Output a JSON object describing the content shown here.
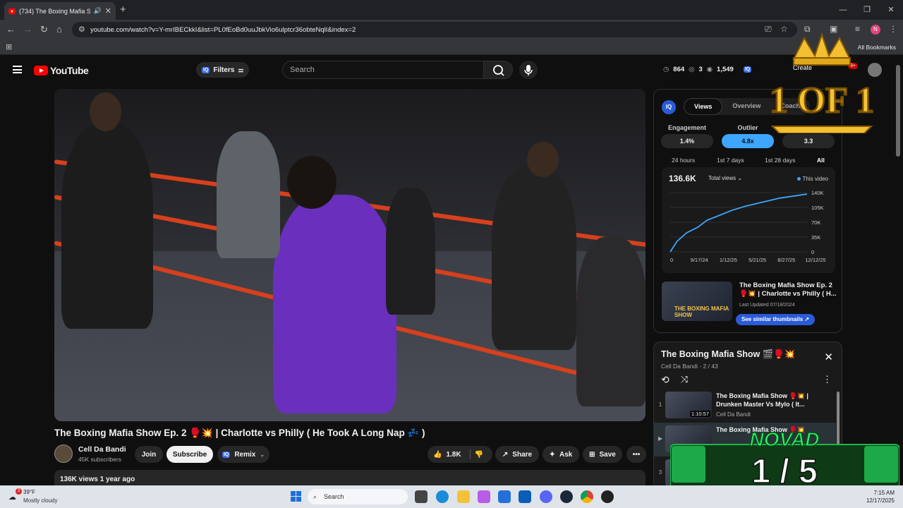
{
  "browser": {
    "tab_title": "(734) The Boxing Mafia Show",
    "url": "youtube.com/watch?v=Y-mrIBECkkI&list=PL0fEoBd0uuJbkVio6ulptcr36obteNqlI&index=2",
    "profile_initial": "N",
    "all_bookmarks": "All Bookmarks"
  },
  "youtube": {
    "logo_text": "YouTube",
    "filters_label": "Filters",
    "search_placeholder": "Search",
    "header_stats": [
      "864",
      "3",
      "1,549"
    ],
    "create_label": "Create",
    "notif_count": "9+"
  },
  "video": {
    "title": "The Boxing Mafia Show Ep. 2 🥊💥 | Charlotte vs Philly ( He Took A Long Nap 💤 )",
    "channel": "Cell Da Bandi",
    "subscribers": "45K subscribers",
    "join": "Join",
    "subscribe": "Subscribe",
    "remix": "Remix",
    "likes": "1.8K",
    "share": "Share",
    "ask": "Ask",
    "save": "Save",
    "meta": "136K views  1 year ago"
  },
  "analytics": {
    "iq": "IQ",
    "tabs": [
      "Views",
      "Overview",
      "Coach"
    ],
    "metrics": [
      {
        "label": "Engagement",
        "value": "1.4%"
      },
      {
        "label": "Outlier",
        "value": "4.8x"
      },
      {
        "label": "",
        "value": "3.3"
      }
    ],
    "ranges": [
      "24 hours",
      "1st 7 days",
      "1st 28 days",
      "All"
    ],
    "total": "136.6K",
    "total_select": "Total views",
    "legend": "This video",
    "related_title": "The Boxing Mafia Show Ep. 2 🥊💥 | Charlotte vs Philly ( H...",
    "related_updated": "Last Updated 07/18/2024",
    "thumb_text": "THE BOXING MAFIA SHOW",
    "similar_btn": "See similar thumbnails ↗"
  },
  "chart_data": {
    "type": "line",
    "x_ticks": [
      "0",
      "9/17/24",
      "1/12/25",
      "5/21/25",
      "8/27/25",
      "12/12/25"
    ],
    "y_ticks": [
      "140K",
      "105K",
      "70K",
      "35K",
      "0"
    ],
    "ylim": [
      0,
      140000
    ],
    "series": [
      {
        "name": "This video",
        "x": [
          0,
          0.05,
          0.12,
          0.2,
          0.27,
          0.35,
          0.45,
          0.55,
          0.68,
          0.8,
          1.0
        ],
        "values": [
          0,
          25000,
          45000,
          58000,
          75000,
          85000,
          98000,
          108000,
          118000,
          127000,
          136600
        ]
      }
    ]
  },
  "playlist": {
    "title": "The Boxing Mafia Show 🎬🥊💥",
    "sub": "Cell Da Bandi - 2 / 43",
    "items": [
      {
        "num": "1",
        "title": "The Boxing Mafia Show 🥊💥 | Drunken Master Vs Mylo ( It...",
        "channel": "Cell Da Bandi",
        "duration": "1:10:57"
      },
      {
        "num": "▶",
        "title": "The Boxing Mafia Show 🥊💥",
        "channel": "",
        "duration": ""
      },
      {
        "num": "3",
        "title": "",
        "channel": "",
        "duration": ""
      }
    ]
  },
  "overlays": {
    "crown_text": "1 OF 1",
    "novad_text": "NOVAD",
    "novad_count": "1 / 5",
    "novad_sub": "DA"
  },
  "taskbar": {
    "weather_badge": "3",
    "temp": "39°F",
    "weather": "Mostly cloudy",
    "search": "Search",
    "time": "7:15 AM",
    "date": "12/17/2025"
  }
}
